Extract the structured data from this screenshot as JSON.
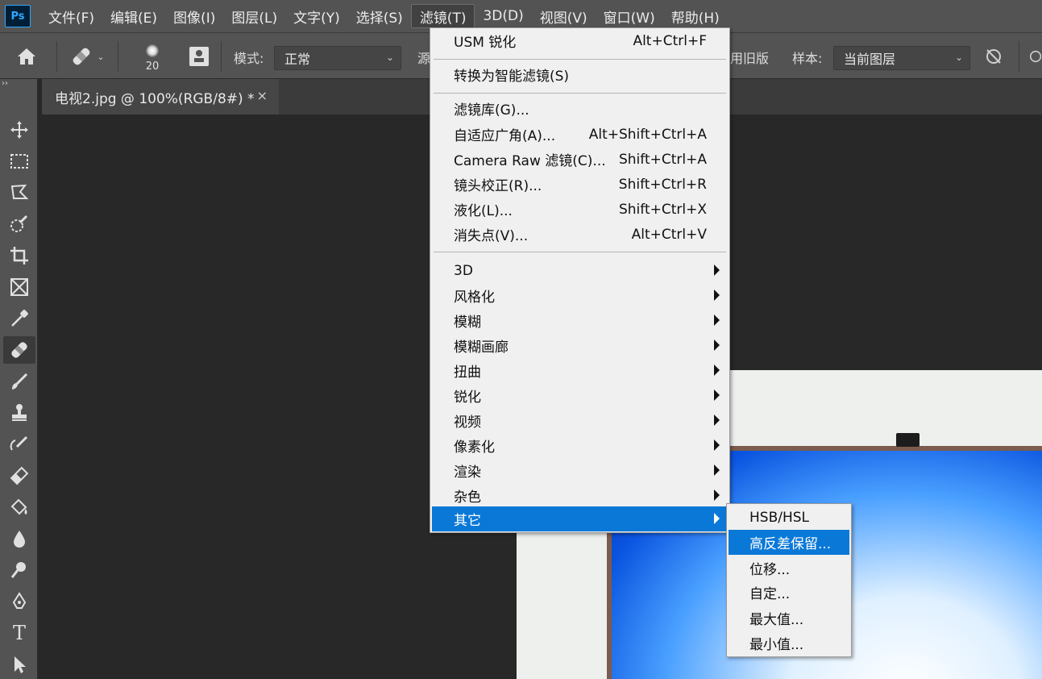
{
  "app": {
    "logo": "Ps"
  },
  "menubar": {
    "items": [
      "文件(F)",
      "编辑(E)",
      "图像(I)",
      "图层(L)",
      "文字(Y)",
      "选择(S)",
      "滤镜(T)",
      "3D(D)",
      "视图(V)",
      "窗口(W)",
      "帮助(H)"
    ],
    "active_index": 6
  },
  "options": {
    "brush_size": "20",
    "mode_label": "模式:",
    "mode_value": "正常",
    "source_label": "源",
    "legacy_label": "用旧版",
    "sample_label": "样本:",
    "sample_value": "当前图层"
  },
  "toolbar": {
    "grip": "››",
    "tools": [
      "move-icon",
      "marquee-icon",
      "lasso-icon",
      "quick-select-icon",
      "crop-icon",
      "frame-icon",
      "eyedropper-icon",
      "healing-brush-icon",
      "brush-icon",
      "clone-stamp-icon",
      "history-brush-icon",
      "eraser-icon",
      "paint-bucket-icon",
      "blur-icon",
      "dodge-icon",
      "pen-icon",
      "type-icon",
      "path-select-icon"
    ],
    "active_tool": "healing-brush-icon",
    "type_glyph": "T"
  },
  "document": {
    "tab_title": "电视2.jpg @ 100%(RGB/8#) *",
    "close_glyph": "×"
  },
  "filter_menu": {
    "items": [
      {
        "label": "USM 锐化",
        "shortcut": "Alt+Ctrl+F"
      },
      {
        "label": "转换为智能滤镜(S)",
        "shortcut": ""
      },
      {
        "label": "滤镜库(G)...",
        "shortcut": ""
      },
      {
        "label": "自适应广角(A)...",
        "shortcut": "Alt+Shift+Ctrl+A"
      },
      {
        "label": "Camera Raw 滤镜(C)...",
        "shortcut": "Shift+Ctrl+A"
      },
      {
        "label": "镜头校正(R)...",
        "shortcut": "Shift+Ctrl+R"
      },
      {
        "label": "液化(L)...",
        "shortcut": "Shift+Ctrl+X"
      },
      {
        "label": "消失点(V)...",
        "shortcut": "Alt+Ctrl+V"
      },
      {
        "label": "3D",
        "shortcut": ""
      },
      {
        "label": "风格化",
        "shortcut": ""
      },
      {
        "label": "模糊",
        "shortcut": ""
      },
      {
        "label": "模糊画廊",
        "shortcut": ""
      },
      {
        "label": "扭曲",
        "shortcut": ""
      },
      {
        "label": "锐化",
        "shortcut": ""
      },
      {
        "label": "视频",
        "shortcut": ""
      },
      {
        "label": "像素化",
        "shortcut": ""
      },
      {
        "label": "渲染",
        "shortcut": ""
      },
      {
        "label": "杂色",
        "shortcut": ""
      },
      {
        "label": "其它",
        "shortcut": ""
      }
    ],
    "highlighted": "其它"
  },
  "other_submenu": {
    "items": [
      "HSB/HSL",
      "高反差保留...",
      "位移...",
      "自定...",
      "最大值...",
      "最小值..."
    ],
    "highlighted": "高反差保留..."
  },
  "colors": {
    "menu_highlight": "#0a78d7",
    "panel_bg": "#535353",
    "canvas_bg": "#282828"
  }
}
